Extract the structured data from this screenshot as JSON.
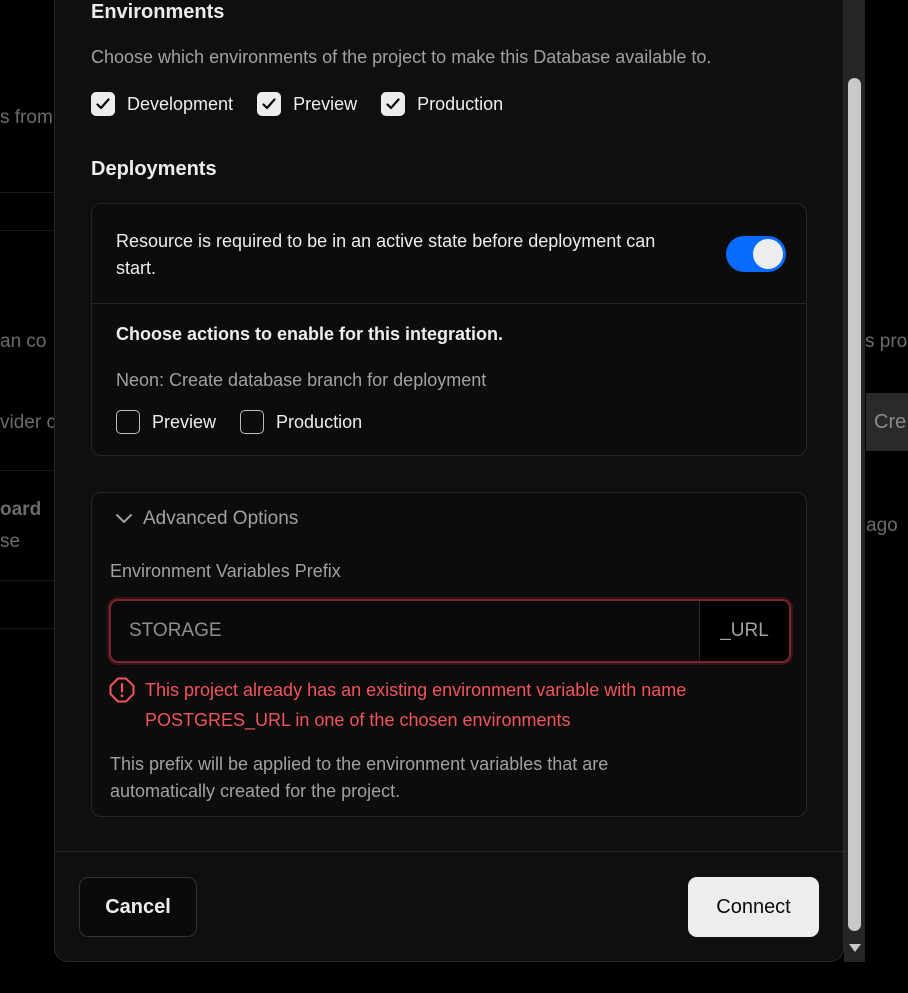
{
  "background": {
    "fragments": [
      "s from",
      "an co",
      "vider c",
      "oard",
      "se",
      "s pro",
      "ago"
    ],
    "right_button": "Cre"
  },
  "modal": {
    "environments": {
      "title": "Environments",
      "description": "Choose which environments of the project to make this Database available to.",
      "options": [
        {
          "label": "Development",
          "checked": true
        },
        {
          "label": "Preview",
          "checked": true
        },
        {
          "label": "Production",
          "checked": true
        }
      ]
    },
    "deployments": {
      "title": "Deployments",
      "required_text": "Resource is required to be in an active state before deployment can start.",
      "toggle_on": true,
      "actions_title": "Choose actions to enable for this integration.",
      "action_description": "Neon: Create database branch for deployment",
      "actions": [
        {
          "label": "Preview",
          "checked": false
        },
        {
          "label": "Production",
          "checked": false
        }
      ]
    },
    "advanced": {
      "toggle_label": "Advanced Options",
      "prefix_label": "Environment Variables Prefix",
      "prefix_value": "STORAGE",
      "prefix_suffix": "_URL",
      "error_message": "This project already has an existing environment variable with name POSTGRES_URL in one of the chosen environments",
      "help_text": "This prefix will be applied to the environment variables that are automatically created for the project."
    },
    "footer": {
      "cancel_label": "Cancel",
      "connect_label": "Connect"
    }
  },
  "colors": {
    "accent": "#0a6cff",
    "error": "#f2545b"
  }
}
